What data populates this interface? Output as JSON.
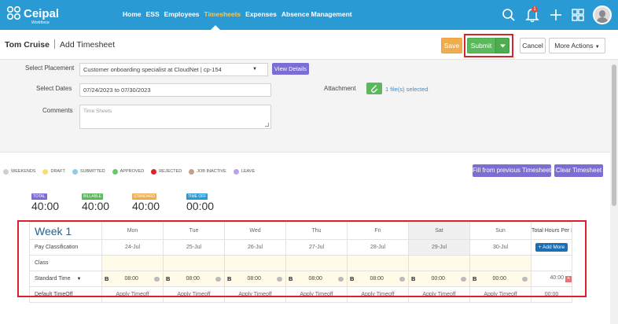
{
  "nav": {
    "brand": "Ceipal",
    "brand_sub": "Workforce",
    "links": [
      "Home",
      "ESS",
      "Employees",
      "Timesheets",
      "Expenses",
      "Absence Management"
    ],
    "active": "Timesheets",
    "notification_count": "1"
  },
  "header": {
    "employee": "Tom Cruise",
    "page": "Add Timesheet",
    "save": "Save",
    "submit": "Submit",
    "cancel": "Cancel",
    "more_actions": "More Actions"
  },
  "form": {
    "placement_label": "Select Placement",
    "placement_value": "Customer onboarding specialist at CloudNet | cp-154",
    "view_details": "View Details",
    "dates_label": "Select Dates",
    "dates_value": "07/24/2023 to 07/30/2023",
    "comments_label": "Comments",
    "comments_placeholder": "Time Sheets",
    "attachment_label": "Attachment",
    "attachment_value": "1 file(s) selected"
  },
  "legend": [
    {
      "label": "WEEKENDS",
      "color": "#cfcfcf"
    },
    {
      "label": "DRAFT",
      "color": "#f7dd7a"
    },
    {
      "label": "SUBMITTED",
      "color": "#8fc9ef"
    },
    {
      "label": "APPROVED",
      "color": "#6ac76a"
    },
    {
      "label": "REJECTED",
      "color": "#d9242b"
    },
    {
      "label": "JOB INACTIVE",
      "color": "#c1a08c"
    },
    {
      "label": "LEAVE",
      "color": "#b9a3e3"
    }
  ],
  "actions": {
    "fill_previous": "Fill from previous Timesheet",
    "clear": "Clear Timesheet"
  },
  "totals": [
    {
      "tag": "TOTAL",
      "value": "40:00",
      "color": "#7a6ed5"
    },
    {
      "tag": "BILLABLE",
      "value": "40:00",
      "color": "#5cb85c"
    },
    {
      "tag": "STANDARD",
      "value": "40:00",
      "color": "#f0ad4e"
    },
    {
      "tag": "TIME OFF",
      "value": "00:00",
      "color": "#2a9ad5"
    }
  ],
  "week": {
    "title": "Week 1",
    "days": [
      "Mon",
      "Tue",
      "Wed",
      "Thu",
      "Fri",
      "Sat",
      "Sun"
    ],
    "dates": [
      "24-Jul",
      "25-Jul",
      "26-Jul",
      "27-Jul",
      "28-Jul",
      "29-Jul",
      "30-Jul"
    ],
    "total_header": "Total Hours Per Item",
    "pay_classification": "Pay Classification",
    "add_more": "+ Add More",
    "class_label": "Class",
    "standard_time": "Standard Time",
    "entry_badge": "B",
    "hours": [
      "08:00",
      "08:00",
      "08:00",
      "08:00",
      "08:00",
      "00:00",
      "00:00"
    ],
    "row_total": "40:00",
    "default_timeoff": "Default TimeOff",
    "apply_timeoff": "Apply Timeoff",
    "timeoff_total": "00:00"
  }
}
